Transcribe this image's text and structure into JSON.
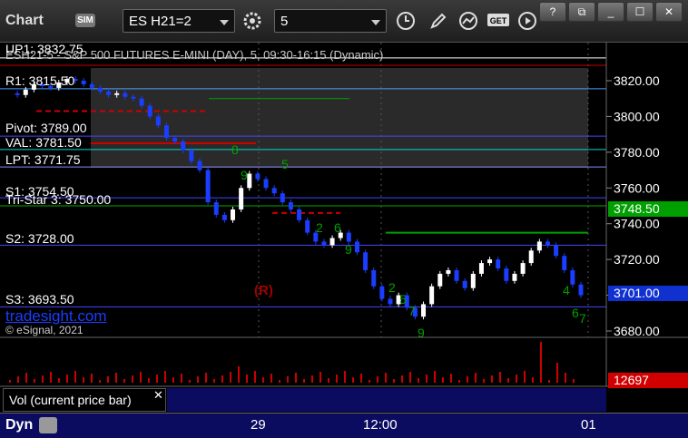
{
  "toolbar": {
    "title": "Chart",
    "sim_badge": "SIM",
    "symbol": "ES H21=2",
    "interval": "5",
    "window_buttons": [
      "?",
      "⧉",
      "_",
      "☐",
      "✕"
    ]
  },
  "chart": {
    "header": "ESH21-5 - S&P 500 FUTURES E-MINI (DAY), 5, 09:30-16:15 (Dynamic)",
    "levels": [
      {
        "label": "UP1: 3832.75",
        "value": 3832.75,
        "color": "#ffffff"
      },
      {
        "label": "R1: 3815.50",
        "value": 3815.5,
        "color": "#4aa0ff"
      },
      {
        "label": "Pivot: 3789.00",
        "value": 3789.0,
        "color": "#4444ff"
      },
      {
        "label": "VAL: 3781.50",
        "value": 3781.5,
        "color": "#00d8d8"
      },
      {
        "label": "LPT: 3771.75",
        "value": 3771.75,
        "color": "#8888ff"
      },
      {
        "label": "S1: 3754.50",
        "value": 3754.5,
        "color": "#4444ff"
      },
      {
        "label": "Tri-Star 3: 3750.00",
        "value": 3750.0,
        "color": "#00aa00"
      },
      {
        "label": "S2: 3728.00",
        "value": 3728.0,
        "color": "#4444ff"
      },
      {
        "label": "S3: 3693.50",
        "value": 3693.5,
        "color": "#4444ff"
      }
    ],
    "y_ticks": [
      "3820.00",
      "3800.00",
      "3780.00",
      "3760.00",
      "3740.00",
      "3720.00",
      "3700.00",
      "3680.00"
    ],
    "price_tag": {
      "label": "3748.50",
      "color": "#00a000"
    },
    "last_tag": {
      "label": "3701.00",
      "color": "#1030d0"
    },
    "volume_tag": {
      "label": "12697",
      "color": "#d00000"
    },
    "x_ticks": [
      "29",
      "12:00",
      "01"
    ],
    "watermark": "tradesight.com",
    "copyright": "© eSignal, 2021",
    "marker_r": "(R)",
    "volume_label": "Vol (current price bar)",
    "bottom_label": "Dyn"
  }
}
